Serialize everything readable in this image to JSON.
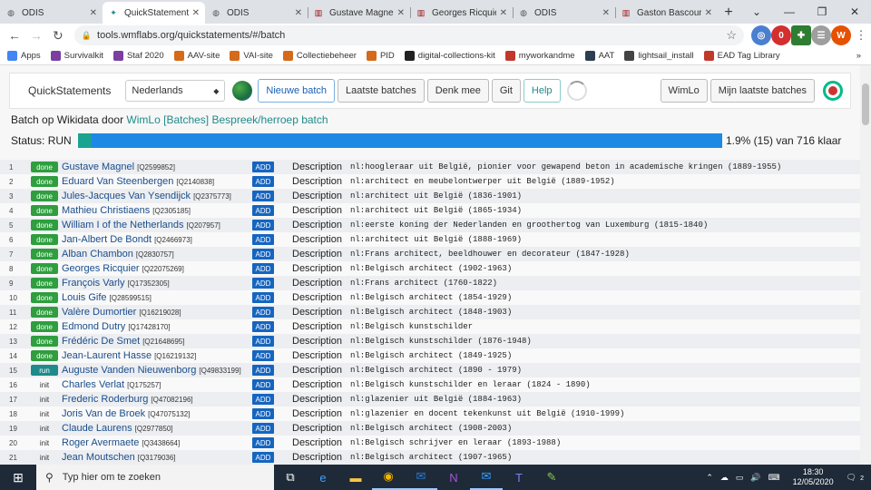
{
  "browser": {
    "tabs": [
      {
        "title": "ODIS",
        "icon": "odis-favicon",
        "active": false
      },
      {
        "title": "QuickStatement",
        "icon": "quickstatements-favicon",
        "active": true
      },
      {
        "title": "ODIS",
        "icon": "odis-favicon",
        "active": false
      },
      {
        "title": "Gustave Magnel",
        "icon": "wikidata-favicon",
        "active": false
      },
      {
        "title": "Georges Ricquie",
        "icon": "wikidata-favicon",
        "active": false
      },
      {
        "title": "ODIS",
        "icon": "odis-favicon",
        "active": false
      },
      {
        "title": "Gaston Bascour",
        "icon": "wikidata-favicon",
        "active": false
      }
    ],
    "url": "tools.wmflabs.org/quickstatements/#/batch",
    "bookmarks": [
      {
        "label": "Apps",
        "color": "#4285f4"
      },
      {
        "label": "Survivalkit",
        "color": "#7b3fa0"
      },
      {
        "label": "Staf 2020",
        "color": "#7b3fa0"
      },
      {
        "label": "AAV-site",
        "color": "#d46a1a"
      },
      {
        "label": "VAI-site",
        "color": "#d46a1a"
      },
      {
        "label": "Collectiebeheer",
        "color": "#d46a1a"
      },
      {
        "label": "PID",
        "color": "#d46a1a"
      },
      {
        "label": "digital-collections-kit",
        "color": "#222222"
      },
      {
        "label": "myworkandme",
        "color": "#c0392b"
      },
      {
        "label": "AAT",
        "color": "#2c3e50"
      },
      {
        "label": "lightsail_install",
        "color": "#444444"
      },
      {
        "label": "EAD Tag Library",
        "color": "#c0392b"
      }
    ]
  },
  "qs": {
    "brand": "QuickStatements",
    "language": "Nederlands",
    "buttons": {
      "new_batch": "Nieuwe batch",
      "last_batches": "Laatste batches",
      "think_along": "Denk mee",
      "git": "Git",
      "help": "Help",
      "user": "WimLo",
      "my_batches": "Mijn laatste batches"
    },
    "batch": {
      "prefix": "Batch op Wikidata door",
      "user": "WimLo",
      "batches_link": "[Batches]",
      "discuss_link": "Bespreek/herroep batch"
    },
    "status": {
      "label": "Status: RUN",
      "progress_fraction": 0.021,
      "summary": "1.9% (15) van 716 klaar"
    },
    "rows": [
      {
        "n": "1",
        "status": "done",
        "label": "Gustave Magnel",
        "qid": "[Q2599852]",
        "action": "ADD",
        "prop": "Description",
        "value": "nl:hoogleraar uit België, pionier voor gewapend beton in academische kringen (1889-1955)"
      },
      {
        "n": "2",
        "status": "done",
        "label": "Eduard Van Steenbergen",
        "qid": "[Q2140838]",
        "action": "ADD",
        "prop": "Description",
        "value": "nl:architect en meubelontwerper uit België (1889-1952)"
      },
      {
        "n": "3",
        "status": "done",
        "label": "Jules-Jacques Van Ysendijck",
        "qid": "[Q2375773]",
        "action": "ADD",
        "prop": "Description",
        "value": "nl:architect uit België (1836-1901)"
      },
      {
        "n": "4",
        "status": "done",
        "label": "Mathieu Christiaens",
        "qid": "[Q2305185]",
        "action": "ADD",
        "prop": "Description",
        "value": "nl:architect uit België (1865-1934)"
      },
      {
        "n": "5",
        "status": "done",
        "label": "William I of the Netherlands",
        "qid": "[Q207957]",
        "action": "ADD",
        "prop": "Description",
        "value": "nl:eerste koning der Nederlanden en groothertog van Luxemburg (1815-1840)"
      },
      {
        "n": "6",
        "status": "done",
        "label": "Jan-Albert De Bondt",
        "qid": "[Q2466973]",
        "action": "ADD",
        "prop": "Description",
        "value": "nl:architect uit België (1888-1969)"
      },
      {
        "n": "7",
        "status": "done",
        "label": "Alban Chambon",
        "qid": "[Q2830757]",
        "action": "ADD",
        "prop": "Description",
        "value": "nl:Frans architect, beeldhouwer en decorateur (1847-1928)"
      },
      {
        "n": "8",
        "status": "done",
        "label": "Georges Ricquier",
        "qid": "[Q22075269]",
        "action": "ADD",
        "prop": "Description",
        "value": "nl:Belgisch architect (1902-1963)"
      },
      {
        "n": "9",
        "status": "done",
        "label": "François Varly",
        "qid": "[Q17352305]",
        "action": "ADD",
        "prop": "Description",
        "value": "nl:Frans architect (1760-1822)"
      },
      {
        "n": "10",
        "status": "done",
        "label": "Louis Gife",
        "qid": "[Q28599515]",
        "action": "ADD",
        "prop": "Description",
        "value": "nl:Belgisch architect (1854-1929)"
      },
      {
        "n": "11",
        "status": "done",
        "label": "Valère Dumortier",
        "qid": "[Q16219028]",
        "action": "ADD",
        "prop": "Description",
        "value": "nl:Belgisch architect (1848-1903)"
      },
      {
        "n": "12",
        "status": "done",
        "label": "Edmond Dutry",
        "qid": "[Q17428170]",
        "action": "ADD",
        "prop": "Description",
        "value": "nl:Belgisch kunstschilder"
      },
      {
        "n": "13",
        "status": "done",
        "label": "Frédéric De Smet",
        "qid": "[Q21648695]",
        "action": "ADD",
        "prop": "Description",
        "value": "nl:Belgisch kunstschilder (1876-1948)"
      },
      {
        "n": "14",
        "status": "done",
        "label": "Jean-Laurent Hasse",
        "qid": "[Q16219132]",
        "action": "ADD",
        "prop": "Description",
        "value": "nl:Belgisch architect (1849-1925)"
      },
      {
        "n": "15",
        "status": "run",
        "label": "Auguste Vanden Nieuwenborg",
        "qid": "[Q49833199]",
        "action": "ADD",
        "prop": "Description",
        "value": "nl:Belgisch architect (1890 - 1979)"
      },
      {
        "n": "16",
        "status": "init",
        "label": "Charles Verlat",
        "qid": "[Q175257]",
        "action": "ADD",
        "prop": "Description",
        "value": "nl:Belgisch kunstschilder en leraar (1824 - 1890)"
      },
      {
        "n": "17",
        "status": "init",
        "label": "Frederic Roderburg",
        "qid": "[Q47082196]",
        "action": "ADD",
        "prop": "Description",
        "value": "nl:glazenier uit België (1884-1963)"
      },
      {
        "n": "18",
        "status": "init",
        "label": "Joris Van de Broek",
        "qid": "[Q47075132]",
        "action": "ADD",
        "prop": "Description",
        "value": "nl:glazenier en docent tekenkunst uit België (1910-1999)"
      },
      {
        "n": "19",
        "status": "init",
        "label": "Claude Laurens",
        "qid": "[Q2977850]",
        "action": "ADD",
        "prop": "Description",
        "value": "nl:Belgisch architect (1908-2003)"
      },
      {
        "n": "20",
        "status": "init",
        "label": "Roger Avermaete",
        "qid": "[Q3438664]",
        "action": "ADD",
        "prop": "Description",
        "value": "nl:Belgisch schrijver en leraar (1893-1988)"
      },
      {
        "n": "21",
        "status": "init",
        "label": "Jean Moutschen",
        "qid": "[Q3179036]",
        "action": "ADD",
        "prop": "Description",
        "value": "nl:Belgisch architect (1907-1965)"
      }
    ]
  },
  "taskbar": {
    "search_placeholder": "Typ hier om te zoeken",
    "time": "18:30",
    "date": "12/05/2020",
    "notifications": "2"
  }
}
